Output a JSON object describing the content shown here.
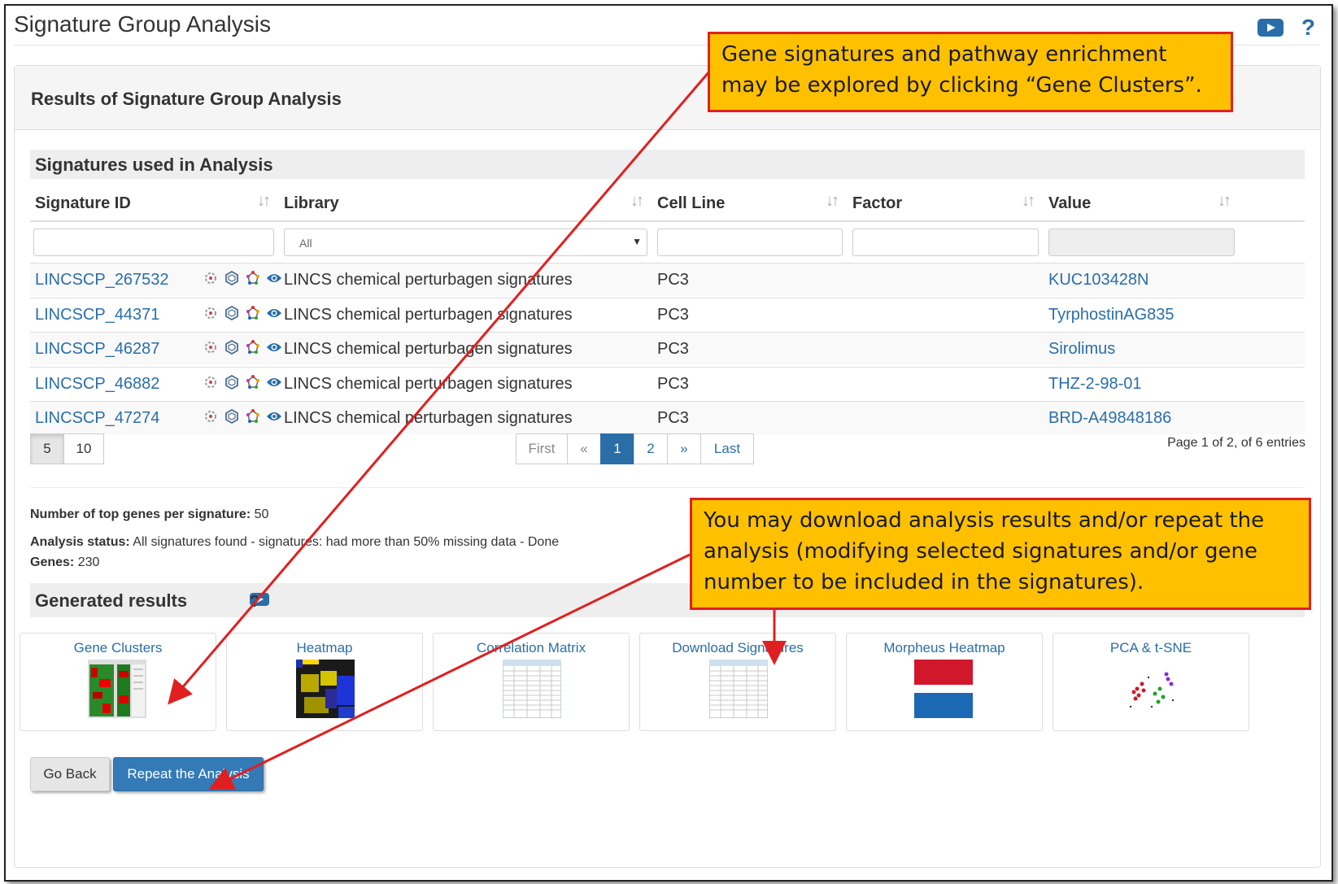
{
  "header": {
    "title": "Signature Group Analysis",
    "help_label": "?"
  },
  "panel": {
    "title": "Results of Signature Group Analysis"
  },
  "signatures_section": {
    "title": "Signatures used in Analysis",
    "columns": [
      "Signature ID",
      "Library",
      "Cell Line",
      "Factor",
      "Value"
    ],
    "sort_glyph": "↓↑",
    "library_filter_value": "All",
    "rows": [
      {
        "id": "LINCSCP_267532",
        "library": "LINCS chemical perturbagen signatures",
        "cell_line": "PC3",
        "factor": "",
        "value": "KUC103428N"
      },
      {
        "id": "LINCSCP_44371",
        "library": "LINCS chemical perturbagen signatures",
        "cell_line": "PC3",
        "factor": "",
        "value": "TyrphostinAG835"
      },
      {
        "id": "LINCSCP_46287",
        "library": "LINCS chemical perturbagen signatures",
        "cell_line": "PC3",
        "factor": "",
        "value": "Sirolimus"
      },
      {
        "id": "LINCSCP_46882",
        "library": "LINCS chemical perturbagen signatures",
        "cell_line": "PC3",
        "factor": "",
        "value": "THZ-2-98-01"
      },
      {
        "id": "LINCSCP_47274",
        "library": "LINCS chemical perturbagen signatures",
        "cell_line": "PC3",
        "factor": "",
        "value": "BRD-A49848186"
      }
    ],
    "row_icons": [
      "gear-network-icon",
      "hexagon-icon",
      "pathway-star-icon",
      "eye-icon"
    ],
    "page_sizes": [
      "5",
      "10"
    ],
    "pagination": [
      "First",
      "«",
      "1",
      "2",
      "»",
      "Last"
    ],
    "current_page": "1",
    "page_info": "Page 1 of 2, of 6 entries"
  },
  "analysis_meta": {
    "top_genes_label": "Number of top genes per signature:",
    "top_genes_value": "50",
    "status_label": "Analysis status:",
    "status_value": "All signatures found - signatures: had more than 50% missing data - Done",
    "genes_label": "Genes:",
    "genes_value": "230"
  },
  "generated_results": {
    "title": "Generated results",
    "help_label": "?",
    "tiles": [
      "Gene Clusters",
      "Heatmap",
      "Correlation Matrix",
      "Download Signatures",
      "Morpheus Heatmap",
      "PCA & t-SNE"
    ]
  },
  "buttons": {
    "back": "Go Back",
    "repeat": "Repeat the Analysis"
  },
  "callouts": {
    "top": "Gene signatures and pathway enrichment may be explored by clicking “Gene Clusters”.",
    "bottom": "You may download analysis results and/or repeat the analysis (modifying selected signatures and/or gene number to be included in the signatures)."
  },
  "colors": {
    "link": "#2a6ea8",
    "primary_button": "#337ab7",
    "callout_fill": "#ffc000",
    "callout_border": "#e02020",
    "arrow": "#e02020"
  }
}
